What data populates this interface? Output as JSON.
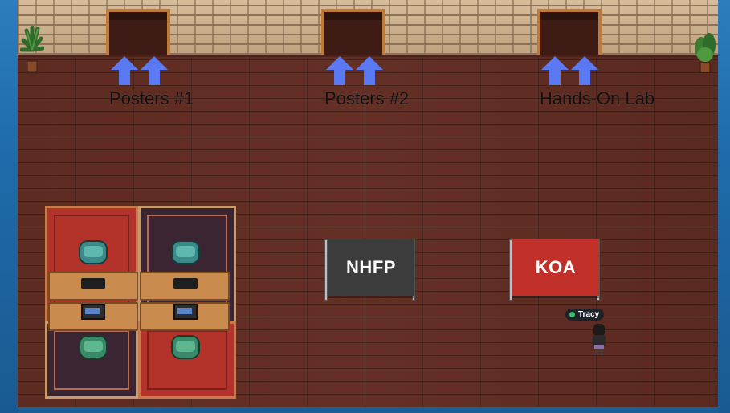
{
  "areas": [
    {
      "label": "Posters #1"
    },
    {
      "label": "Posters #2"
    },
    {
      "label": "Hands-On Lab"
    }
  ],
  "signs": [
    {
      "text": "NHFP",
      "color": "#3c3c3c"
    },
    {
      "text": "KOA",
      "color": "#c23129"
    }
  ],
  "player": {
    "name": "Tracy",
    "status": "online",
    "status_color": "#34c26b"
  },
  "icons": {
    "arrow": "up-arrow-icon",
    "plant": "potted-plant-icon",
    "chair": "chair-icon"
  },
  "colors": {
    "arrow": "#5b79f2",
    "floor": "#5c2a20",
    "wall": "#c9ae8a",
    "door_frame": "#c07a38"
  }
}
